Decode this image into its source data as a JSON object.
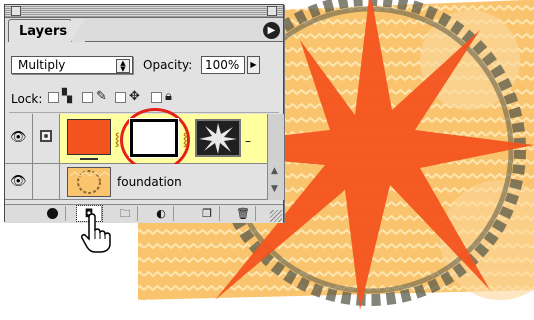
{
  "palette": {
    "tab_label": "Layers",
    "menu_arrow_glyph": "▶",
    "blend_mode": "Multiply",
    "opacity_label": "Opacity:",
    "opacity_value": "100%",
    "lock_label": "Lock:"
  },
  "layers": [
    {
      "name": "",
      "thumbnail": "solid-fill-orange",
      "has_mask": true,
      "has_vector_mask": true,
      "selected": true
    },
    {
      "name": "foundation",
      "thumbnail": "pattern-yellow",
      "selected": false
    }
  ],
  "layer_suffix": "–",
  "bottom_buttons": [
    "add-layer-style",
    "add-layer-mask",
    "new-layer-set",
    "new-fill-adjustment-layer",
    "new-layer",
    "delete-layer"
  ],
  "colors": {
    "fill_orange": "#f3541f",
    "selected_row": "#ffffa0",
    "highlight_circle": "#e3201b",
    "canvas_background": "#f9c46d"
  },
  "icons": {
    "eye": "eye-icon",
    "link": "link-icon",
    "cursor": "hand-pointer-icon"
  }
}
